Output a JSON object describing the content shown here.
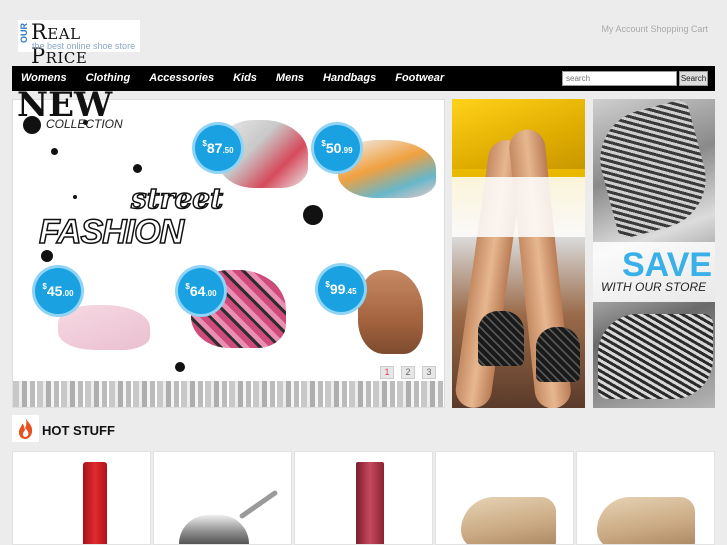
{
  "header": {
    "logo_small": "OUR",
    "logo_brand": "Real Price",
    "logo_tagline": "the best online shoe store",
    "account_links": "My Account  Shopping Cart"
  },
  "nav": {
    "items": [
      {
        "label": "Womens"
      },
      {
        "label": "Clothing"
      },
      {
        "label": "Accessories"
      },
      {
        "label": "Kids"
      },
      {
        "label": "Mens"
      },
      {
        "label": "Handbags"
      },
      {
        "label": "Footwear"
      }
    ]
  },
  "search": {
    "placeholder": "search",
    "button_label": "Search"
  },
  "hero": {
    "line1": "street",
    "line2": "FASHION",
    "prices": [
      {
        "currency": "$",
        "whole": "87",
        "cents": ".50"
      },
      {
        "currency": "$",
        "whole": "50",
        "cents": ".99"
      },
      {
        "currency": "$",
        "whole": "45",
        "cents": ".00"
      },
      {
        "currency": "$",
        "whole": "64",
        "cents": ".00"
      },
      {
        "currency": "$",
        "whole": "99",
        "cents": ".45"
      }
    ],
    "pages": [
      "1",
      "2",
      "3"
    ]
  },
  "promo_new": {
    "title": "NEW",
    "subtitle": "COLLECTION"
  },
  "promo_save": {
    "title": "SAVE",
    "subtitle": "WITH OUR STORE"
  },
  "hot_stuff": {
    "title": "HOT STUFF"
  },
  "colors": {
    "accent_blue": "#19a1e2",
    "nav_bg": "#000000",
    "flame": "#e8501c"
  }
}
